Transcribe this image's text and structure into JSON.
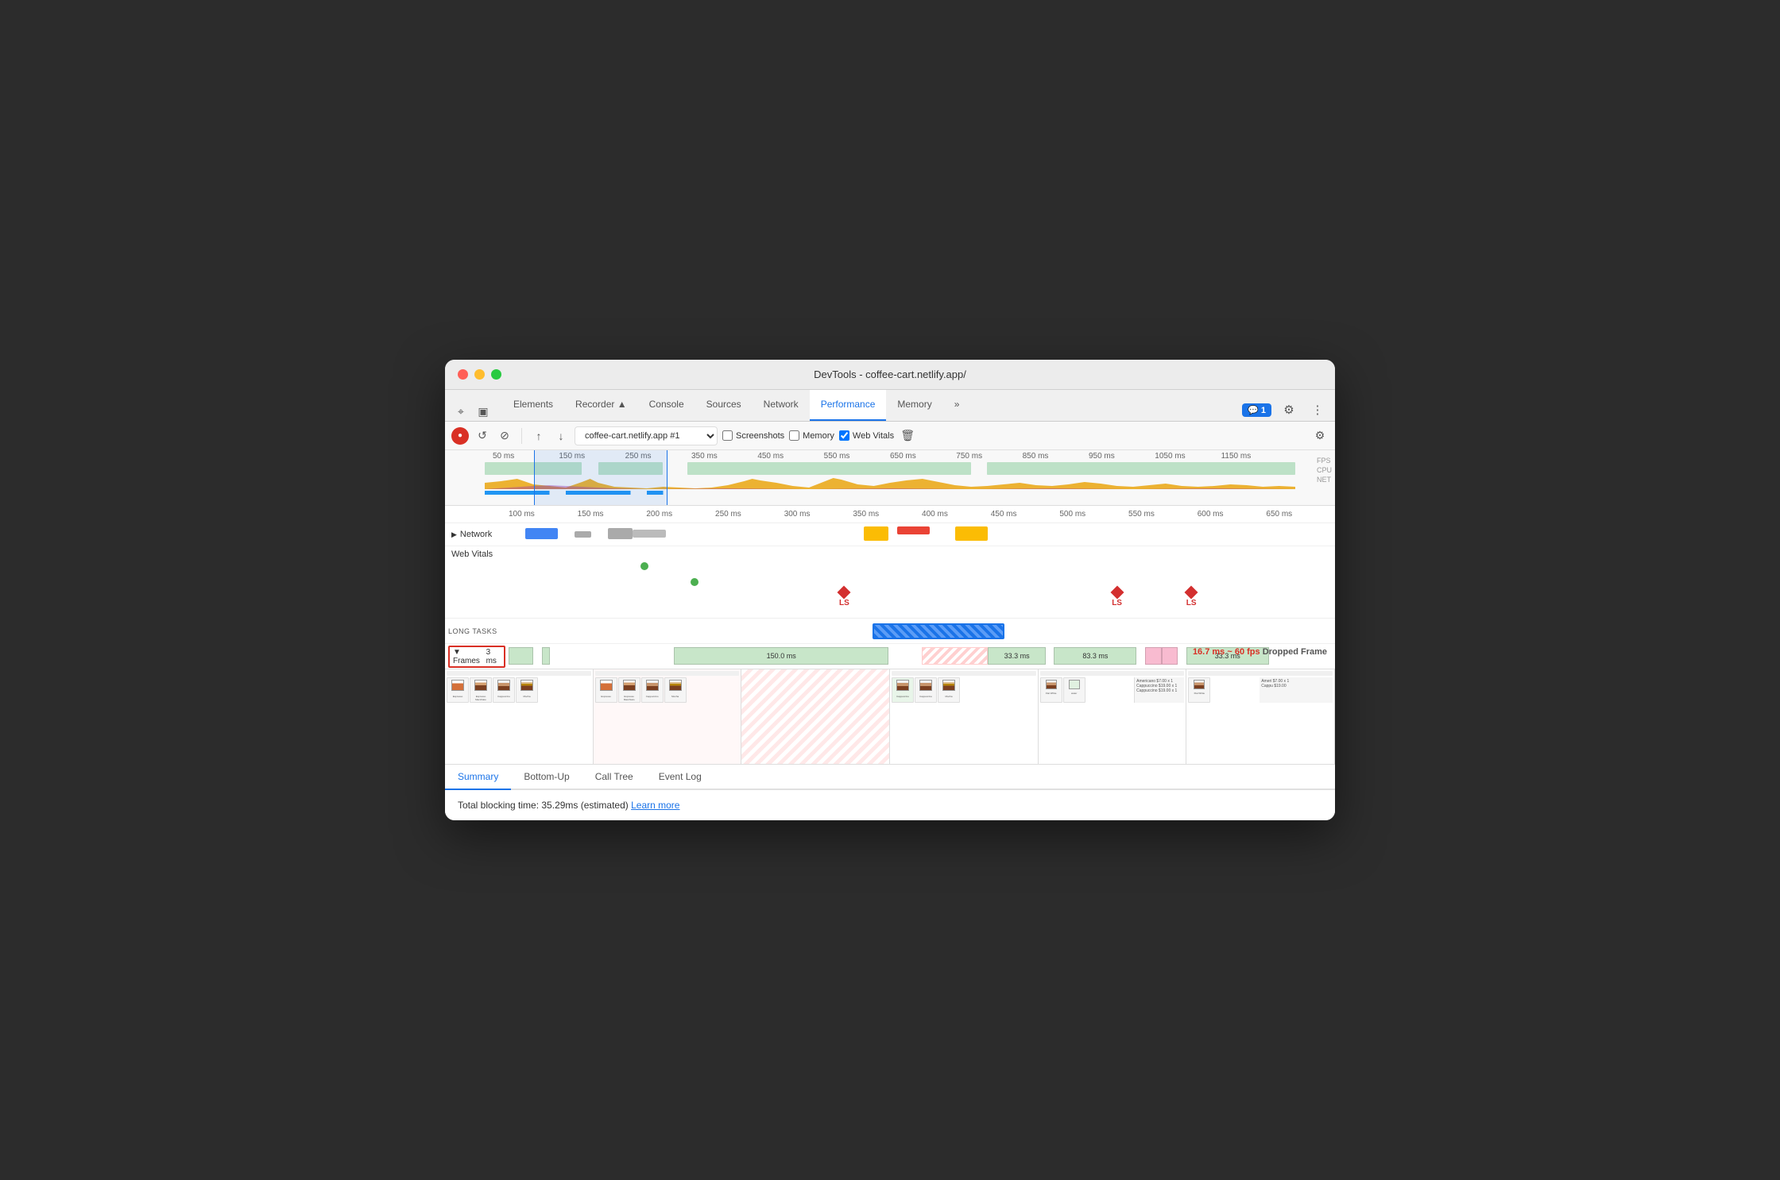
{
  "window": {
    "title": "DevTools - coffee-cart.netlify.app/"
  },
  "tabs": {
    "items": [
      "Elements",
      "Recorder ▲",
      "Console",
      "Sources",
      "Network",
      "Performance",
      "Memory",
      "»"
    ],
    "active": "Performance"
  },
  "toolbar": {
    "record_label": "●",
    "reload_label": "↺",
    "clear_label": "⊘",
    "upload_label": "↑",
    "download_label": "↓",
    "url_value": "coffee-cart.netlify.app #1",
    "screenshots_label": "Screenshots",
    "memory_label": "Memory",
    "webvitals_label": "Web Vitals",
    "settings_label": "⚙"
  },
  "overview": {
    "ruler_labels": [
      "50 ms",
      "150 ms",
      "250 ms",
      "350 ms",
      "450 ms",
      "550 ms",
      "650 ms",
      "750 ms",
      "850 ms",
      "950 ms",
      "1050 ms",
      "1150 ms"
    ],
    "fps_label": "FPS",
    "cpu_label": "CPU",
    "net_label": "NET"
  },
  "timeline": {
    "ruler_labels": [
      "100 ms",
      "150 ms",
      "200 ms",
      "250 ms",
      "300 ms",
      "350 ms",
      "400 ms",
      "450 ms",
      "500 ms",
      "550 ms",
      "600 ms",
      "650 ms"
    ],
    "network_label": "▶ Network",
    "webvitals_label": "Web Vitals",
    "ls_labels": [
      "LS",
      "LS",
      "LS"
    ],
    "long_tasks_label": "LONG TASKS",
    "frames_label": "▼ Frames",
    "frames_value": "3 ms",
    "frame_segments": [
      {
        "label": "",
        "width": "4%",
        "left": "0%",
        "color": "green"
      },
      {
        "label": "150.0 ms",
        "width": "28%",
        "left": "20%",
        "color": "green"
      },
      {
        "label": "33.3 ms",
        "width": "8%",
        "left": "52%",
        "color": "green"
      },
      {
        "label": "83.3 ms",
        "width": "10%",
        "left": "61%",
        "color": "green"
      },
      {
        "label": "33.3 ms",
        "width": "12%",
        "left": "80%",
        "color": "green"
      }
    ]
  },
  "dropped_frame": {
    "label": "16.7 ms ~ 60 fps",
    "suffix": "Dropped Frame"
  },
  "summary_tabs": [
    "Summary",
    "Bottom-Up",
    "Call Tree",
    "Event Log"
  ],
  "summary": {
    "blocking_time": "Total blocking time: 35.29ms (estimated)",
    "learn_more": "Learn more"
  },
  "colors": {
    "accent": "#1a73e8",
    "record": "#d93025",
    "green": "#4caf50",
    "cpu_yellow": "#e8a000",
    "net_blue": "#2196f3"
  }
}
